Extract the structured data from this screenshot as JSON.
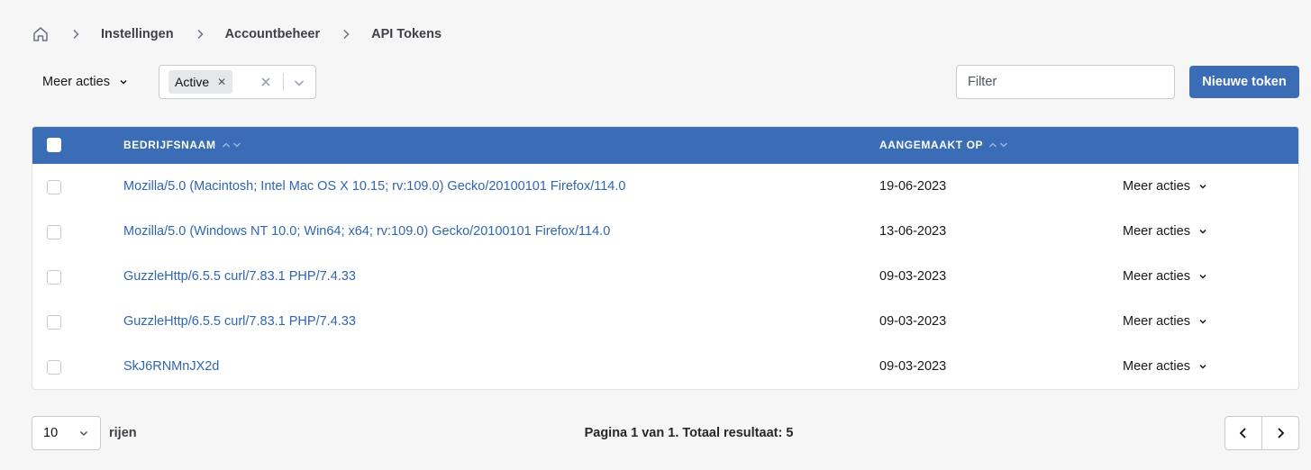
{
  "breadcrumb": {
    "home_icon": "home-icon",
    "items": [
      "Instellingen",
      "Accountbeheer",
      "API Tokens"
    ]
  },
  "toolbar": {
    "bulk_actions_label": "Meer acties",
    "status_filter": {
      "selected_tag": "Active"
    },
    "filter_placeholder": "Filter",
    "new_token_label": "Nieuwe token"
  },
  "table": {
    "columns": [
      "BEDRIJFSNAAM",
      "AANGEMAAKT OP"
    ],
    "rows": [
      {
        "name": "Mozilla/5.0 (Macintosh; Intel Mac OS X 10.15; rv:109.0) Gecko/20100101 Firefox/114.0",
        "created": "19-06-2023",
        "actions": "Meer acties"
      },
      {
        "name": "Mozilla/5.0 (Windows NT 10.0; Win64; x64; rv:109.0) Gecko/20100101 Firefox/114.0",
        "created": "13-06-2023",
        "actions": "Meer acties"
      },
      {
        "name": "GuzzleHttp/6.5.5 curl/7.83.1 PHP/7.4.33",
        "created": "09-03-2023",
        "actions": "Meer acties"
      },
      {
        "name": "GuzzleHttp/6.5.5 curl/7.83.1 PHP/7.4.33",
        "created": "09-03-2023",
        "actions": "Meer acties"
      },
      {
        "name": "SkJ6RNMnJX2d",
        "created": "09-03-2023",
        "actions": "Meer acties"
      }
    ]
  },
  "footer": {
    "page_size": "10",
    "rows_label": "rijen",
    "pagination_info": "Pagina 1 van 1. Totaal resultaat: 5"
  },
  "colors": {
    "primary": "#3a6db5",
    "link": "#2f66b0",
    "background": "#f6f6f7"
  }
}
